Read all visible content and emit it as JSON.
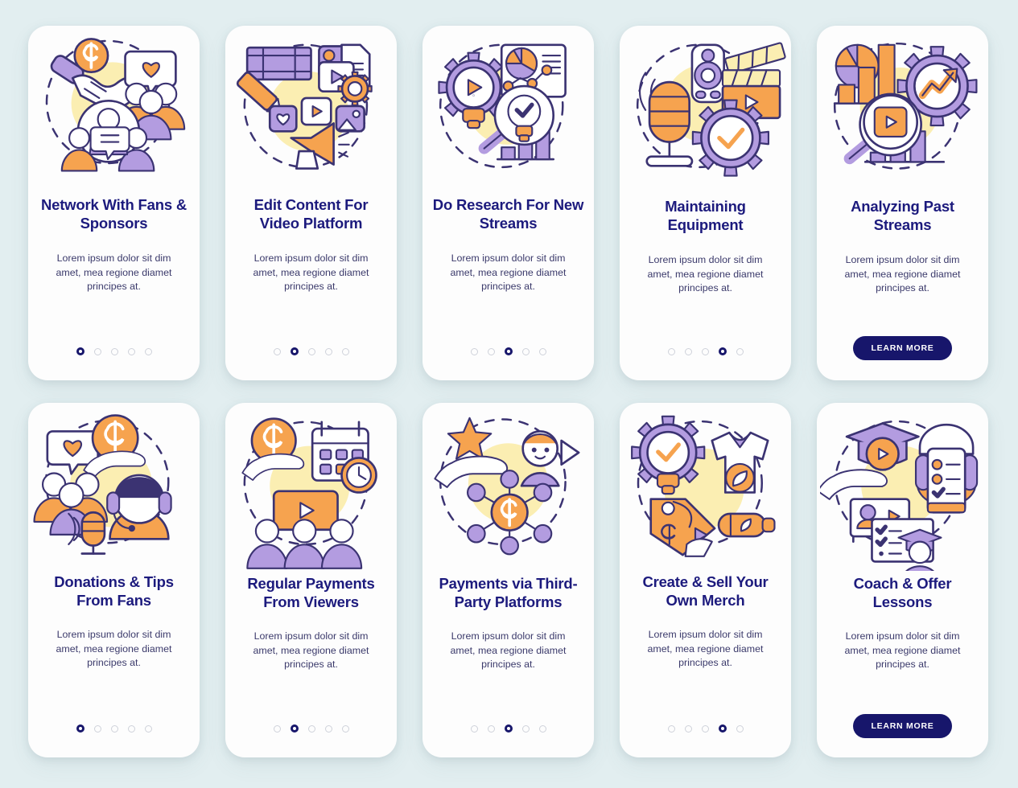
{
  "theme": {
    "background": "#e2eef0",
    "card_background": "#fdfdfd",
    "title_color": "#1c1a7d",
    "body_color": "#3b3a6b",
    "accent_orange": "#f6a34f",
    "accent_purple": "#b39ce0",
    "accent_navy": "#3b3372",
    "blob_yellow": "#fbeeb2",
    "button_color": "#17166b",
    "dot_inactive": "#cfd2da",
    "dot_active": "#17166b"
  },
  "common": {
    "body_text": "Lorem ipsum dolor sit dim amet, mea regione diamet principes at.",
    "learn_more_label": "LEARN MORE",
    "dot_count": 5
  },
  "cards": [
    {
      "id": "network-with-fans-sponsors",
      "title": "Network With Fans & Sponsors",
      "illustration": "handshake-dollar-community-icon",
      "body_text": "Lorem ipsum dolor sit dim amet, mea regione diamet principes at.",
      "footer_type": "dots",
      "active_dot": 0,
      "dot_count": 5,
      "button_label": null
    },
    {
      "id": "edit-content-for-video-platform",
      "title": "Edit Content For Video Platform",
      "illustration": "film-edit-megaphone-icon",
      "body_text": "Lorem ipsum dolor sit dim amet, mea regione diamet principes at.",
      "footer_type": "dots",
      "active_dot": 1,
      "dot_count": 5,
      "button_label": null
    },
    {
      "id": "do-research-for-new-streams",
      "title": "Do Research For New Streams",
      "illustration": "gear-play-chart-magnifier-icon",
      "body_text": "Lorem ipsum dolor sit dim amet, mea regione diamet principes at.",
      "footer_type": "dots",
      "active_dot": 2,
      "dot_count": 5,
      "button_label": null
    },
    {
      "id": "maintaining-equipment",
      "title": "Maintaining Equipment",
      "illustration": "microphone-camera-clapper-gear-icon",
      "body_text": "Lorem ipsum dolor sit dim amet, mea regione diamet principes at.",
      "footer_type": "dots",
      "active_dot": 3,
      "dot_count": 5,
      "button_label": null
    },
    {
      "id": "analyzing-past-streams",
      "title": "Analyzing Past Streams",
      "illustration": "bar-chart-gear-trend-magnifier-icon",
      "body_text": "Lorem ipsum dolor sit dim amet, mea regione diamet principes at.",
      "footer_type": "button",
      "active_dot": null,
      "dot_count": 5,
      "button_label": "LEARN MORE"
    },
    {
      "id": "donations-tips-from-fans",
      "title": "Donations & Tips From Fans",
      "illustration": "hand-coin-streamer-community-icon",
      "body_text": "Lorem ipsum dolor sit dim amet, mea regione diamet principes at.",
      "footer_type": "dots",
      "active_dot": 0,
      "dot_count": 5,
      "button_label": null
    },
    {
      "id": "regular-payments-from-viewers",
      "title": "Regular Payments From Viewers",
      "illustration": "hand-coin-calendar-clock-icon",
      "body_text": "Lorem ipsum dolor sit dim amet, mea regione diamet principes at.",
      "footer_type": "dots",
      "active_dot": 1,
      "dot_count": 5,
      "button_label": null
    },
    {
      "id": "payments-via-third-party-platforms",
      "title": "Payments via Third-Party Platforms",
      "illustration": "star-hand-user-network-coin-icon",
      "body_text": "Lorem ipsum dolor sit dim amet, mea regione diamet principes at.",
      "footer_type": "dots",
      "active_dot": 2,
      "dot_count": 5,
      "button_label": null
    },
    {
      "id": "create-sell-your-own-merch",
      "title": "Create & Sell Your Own Merch",
      "illustration": "gear-bulb-tshirt-bottle-pricetag-icon",
      "body_text": "Lorem ipsum dolor sit dim amet, mea regione diamet principes at.",
      "footer_type": "dots",
      "active_dot": 3,
      "dot_count": 5,
      "button_label": null
    },
    {
      "id": "coach-offer-lessons",
      "title": "Coach & Offer Lessons",
      "illustration": "graduation-cap-lesson-checklist-icon",
      "body_text": "Lorem ipsum dolor sit dim amet, mea regione diamet principes at.",
      "footer_type": "button",
      "active_dot": null,
      "dot_count": 5,
      "button_label": "LEARN MORE"
    }
  ]
}
